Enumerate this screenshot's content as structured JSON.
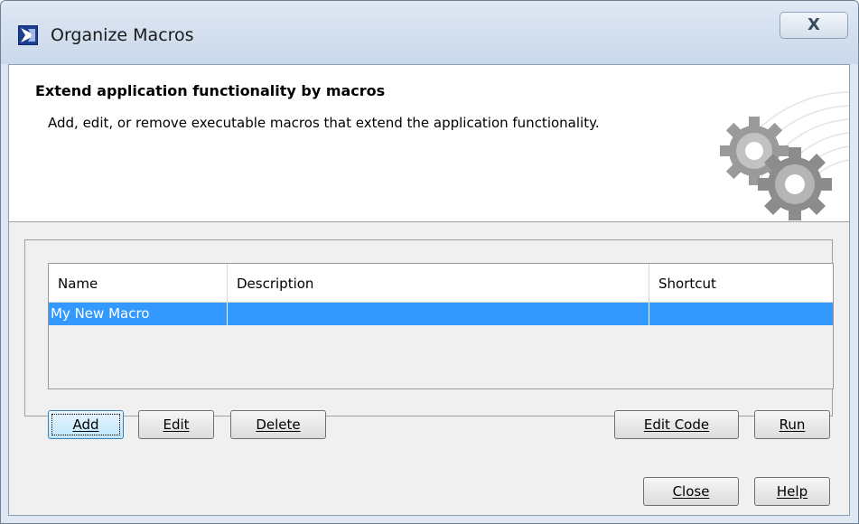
{
  "window": {
    "title": "Organize Macros",
    "close_symbol": "X"
  },
  "header": {
    "title": "Extend application functionality by macros",
    "description": "Add, edit, or remove executable macros that extend the application functionality."
  },
  "table": {
    "columns": [
      "Name",
      "Description",
      "Shortcut"
    ],
    "rows": [
      {
        "name": "My New Macro",
        "description": "",
        "shortcut": "",
        "selected": true
      }
    ]
  },
  "buttons": {
    "add": "Add",
    "edit": "Edit",
    "delete": "Delete",
    "edit_code": "Edit Code",
    "run": "Run",
    "close": "Close",
    "help": "Help"
  },
  "colors": {
    "selection": "#3399ff",
    "window_frame": "#c9d8ea"
  },
  "icons": {
    "app": "magicdraw-app-icon",
    "header": "gears-icon"
  }
}
